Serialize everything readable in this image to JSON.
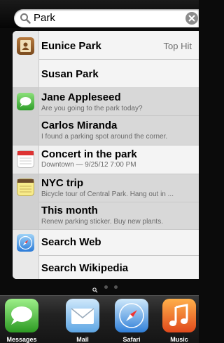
{
  "search": {
    "query": "Park"
  },
  "results": [
    {
      "title": "Eunice Park",
      "badge": "Top Hit",
      "icon": "contacts-icon"
    },
    {
      "title": "Susan Park"
    },
    {
      "title": "Jane Appleseed",
      "subtitle": "Are you going to the park today?",
      "icon": "messages-icon"
    },
    {
      "title": "Carlos Miranda",
      "subtitle": "I found a parking spot around the corner."
    },
    {
      "title": "Concert in the park",
      "subtitle": "Downtown — 9/25/12 7:00 PM",
      "icon": "calendar-icon"
    },
    {
      "title": "NYC trip",
      "subtitle": "Bicycle tour of Central Park. Hang out in ...",
      "icon": "notes-icon"
    },
    {
      "title": "This month",
      "subtitle": "Renew parking sticker. Buy new plants."
    },
    {
      "title": "Search Web",
      "icon": "safari-icon"
    },
    {
      "title": "Search Wikipedia"
    }
  ],
  "dock": [
    {
      "label": "Messages",
      "icon": "messages-icon"
    },
    {
      "label": "Mail",
      "icon": "mail-icon"
    },
    {
      "label": "Safari",
      "icon": "safari-icon"
    },
    {
      "label": "Music",
      "icon": "music-icon"
    }
  ],
  "page_indicator": {
    "pages": 3,
    "current": 0
  }
}
